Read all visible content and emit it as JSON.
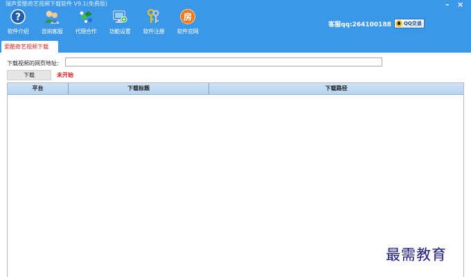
{
  "window": {
    "title": "瑞声爱酷奇艺视频下载软件 V9.1(免费版)",
    "minimize_symbol": "–",
    "close_symbol": "×"
  },
  "toolbar": {
    "items": [
      {
        "label": "软件介绍",
        "icon": "help-icon"
      },
      {
        "label": "咨询客服",
        "icon": "customer-service-icon"
      },
      {
        "label": "代理合作",
        "icon": "partner-icon"
      },
      {
        "label": "功能设置",
        "icon": "settings-icon"
      },
      {
        "label": "软件注册",
        "icon": "register-key-icon"
      },
      {
        "label": "软件官网",
        "icon": "official-site-icon"
      }
    ],
    "official_site_glyph": "房"
  },
  "support": {
    "text": "客服qq:264100188",
    "qq_button_label": "QQ交谈"
  },
  "tabs": [
    {
      "label": "爱酷奇艺视频下载",
      "active": true
    }
  ],
  "form": {
    "url_label": "下载视频的网页地址:",
    "url_value": "",
    "download_button": "下载",
    "status": "未开始"
  },
  "table": {
    "columns": [
      "平台",
      "下载标题",
      "下载路径"
    ],
    "rows": []
  },
  "watermark": "最需教育",
  "colors": {
    "header_bg": "#3b97e8",
    "status_red": "#e01a1a",
    "tab_red": "#e02020",
    "table_header": "#c3dbf3"
  }
}
